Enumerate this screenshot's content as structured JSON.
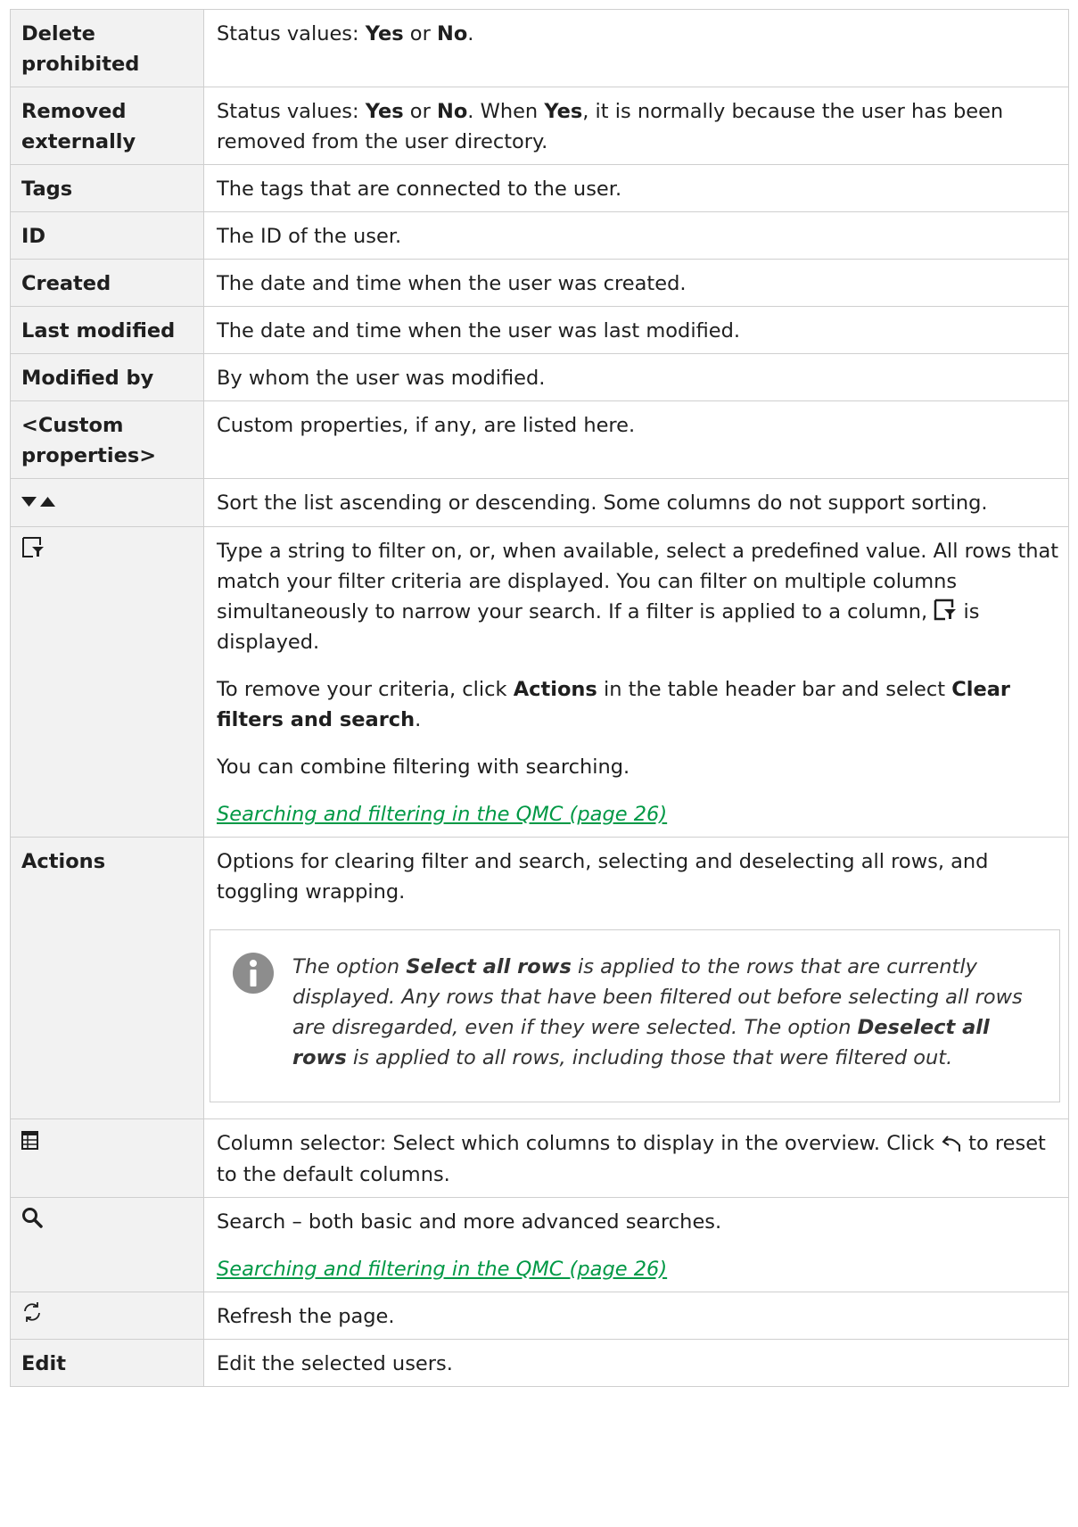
{
  "rows": [
    {
      "name": "Delete prohibited",
      "desc": [
        "Status values: ",
        {
          "b": "Yes"
        },
        " or ",
        {
          "b": "No"
        },
        "."
      ]
    },
    {
      "name": "Removed externally",
      "desc": [
        "Status values: ",
        {
          "b": "Yes"
        },
        " or ",
        {
          "b": "No"
        },
        ". When ",
        {
          "b": "Yes"
        },
        ", it is normally because the user has been removed from the user directory."
      ]
    },
    {
      "name": "Tags",
      "desc": "The tags that are connected to the user."
    },
    {
      "name": "ID",
      "desc": "The ID of the user."
    },
    {
      "name": "Created",
      "desc": "The date and time when the user was created."
    },
    {
      "name": "Last modified",
      "desc": "The date and time when the user was last modified."
    },
    {
      "name": "Modified by",
      "desc": "By whom the user was modified."
    },
    {
      "name": "<Custom properties>",
      "desc": "Custom properties, if any, are listed here."
    },
    {
      "icon": "sort-arrows-icon",
      "desc": "Sort the list ascending or descending. Some columns do not support sorting."
    },
    {
      "icon": "filter-icon",
      "para1": [
        "Type a string to filter on, or, when available, select a predefined value. All rows that match your filter criteria are displayed. You can filter on multiple columns simultaneously to narrow your search. If a filter is applied to a column, ",
        {
          "icon": "filter-applied-icon"
        },
        " is displayed."
      ],
      "para2": [
        "To remove your criteria, click ",
        {
          "b": "Actions"
        },
        " in the table header bar and select ",
        {
          "b": "Clear filters and search"
        },
        "."
      ],
      "para3": "You can combine filtering with searching.",
      "link": "Searching and filtering in the QMC (page 26)"
    },
    {
      "name": "Actions",
      "desc": "Options for clearing filter and search, selecting and deselecting all rows, and toggling wrapping.",
      "note": [
        "The option ",
        {
          "b": "Select all rows"
        },
        " is applied to the rows that are currently displayed. Any rows that have been filtered out before selecting all rows are disregarded, even if they were selected. The option ",
        {
          "b": "Deselect all rows"
        },
        " is applied to all rows, including those that were filtered out."
      ]
    },
    {
      "icon": "column-selector-icon",
      "desc": [
        "Column selector: Select which columns to display in the overview. Click ",
        {
          "icon": "reset-arrow-icon"
        },
        " to reset to the default columns."
      ]
    },
    {
      "icon": "search-icon",
      "desc": "Search – both basic and more advanced searches.",
      "link": "Searching and filtering in the QMC (page 26)"
    },
    {
      "icon": "refresh-icon",
      "desc": "Refresh the page."
    },
    {
      "name": "Edit",
      "desc": "Edit the selected users."
    }
  ]
}
